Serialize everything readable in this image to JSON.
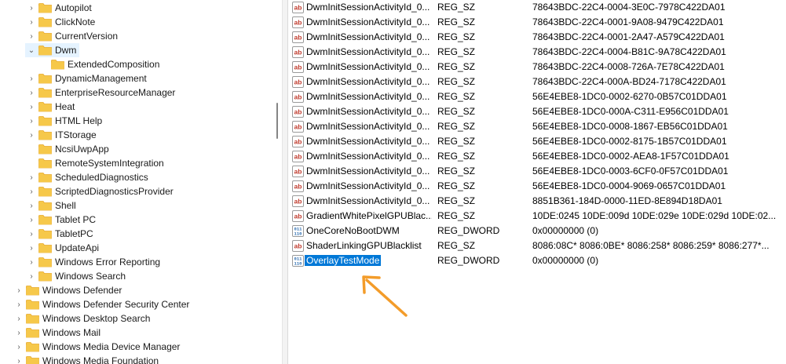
{
  "tree": {
    "items": [
      {
        "label": "Autopilot",
        "expander": "›",
        "level": 2
      },
      {
        "label": "ClickNote",
        "expander": "›",
        "level": 2
      },
      {
        "label": "CurrentVersion",
        "expander": "›",
        "level": 2
      },
      {
        "label": "Dwm",
        "expander": "⌄",
        "level": 2,
        "selected": true
      },
      {
        "label": "ExtendedComposition",
        "expander": "",
        "level": 3
      },
      {
        "label": "DynamicManagement",
        "expander": "›",
        "level": 2
      },
      {
        "label": "EnterpriseResourceManager",
        "expander": "›",
        "level": 2
      },
      {
        "label": "Heat",
        "expander": "›",
        "level": 2
      },
      {
        "label": "HTML Help",
        "expander": "›",
        "level": 2
      },
      {
        "label": "ITStorage",
        "expander": "›",
        "level": 2
      },
      {
        "label": "NcsiUwpApp",
        "expander": "",
        "level": 2
      },
      {
        "label": "RemoteSystemIntegration",
        "expander": "",
        "level": 2
      },
      {
        "label": "ScheduledDiagnostics",
        "expander": "›",
        "level": 2
      },
      {
        "label": "ScriptedDiagnosticsProvider",
        "expander": "›",
        "level": 2
      },
      {
        "label": "Shell",
        "expander": "›",
        "level": 2
      },
      {
        "label": "Tablet PC",
        "expander": "›",
        "level": 2
      },
      {
        "label": "TabletPC",
        "expander": "›",
        "level": 2
      },
      {
        "label": "UpdateApi",
        "expander": "›",
        "level": 2
      },
      {
        "label": "Windows Error Reporting",
        "expander": "›",
        "level": 2
      },
      {
        "label": "Windows Search",
        "expander": "›",
        "level": 2
      },
      {
        "label": "Windows Defender",
        "expander": "›",
        "level": 1
      },
      {
        "label": "Windows Defender Security Center",
        "expander": "›",
        "level": 1
      },
      {
        "label": "Windows Desktop Search",
        "expander": "›",
        "level": 1
      },
      {
        "label": "Windows Mail",
        "expander": "›",
        "level": 1
      },
      {
        "label": "Windows Media Device Manager",
        "expander": "›",
        "level": 1
      },
      {
        "label": "Windows Media Foundation",
        "expander": "›",
        "level": 1
      }
    ]
  },
  "values": {
    "rows": [
      {
        "icon": "string-value-icon",
        "name": "DwmInitSessionActivityId_0...",
        "type": "REG_SZ",
        "data": "78643BDC-22C4-0004-3E0C-7978C422DA01"
      },
      {
        "icon": "string-value-icon",
        "name": "DwmInitSessionActivityId_0...",
        "type": "REG_SZ",
        "data": "78643BDC-22C4-0001-9A08-9479C422DA01"
      },
      {
        "icon": "string-value-icon",
        "name": "DwmInitSessionActivityId_0...",
        "type": "REG_SZ",
        "data": "78643BDC-22C4-0001-2A47-A579C422DA01"
      },
      {
        "icon": "string-value-icon",
        "name": "DwmInitSessionActivityId_0...",
        "type": "REG_SZ",
        "data": "78643BDC-22C4-0004-B81C-9A78C422DA01"
      },
      {
        "icon": "string-value-icon",
        "name": "DwmInitSessionActivityId_0...",
        "type": "REG_SZ",
        "data": "78643BDC-22C4-0008-726A-7E78C422DA01"
      },
      {
        "icon": "string-value-icon",
        "name": "DwmInitSessionActivityId_0...",
        "type": "REG_SZ",
        "data": "78643BDC-22C4-000A-BD24-7178C422DA01"
      },
      {
        "icon": "string-value-icon",
        "name": "DwmInitSessionActivityId_0...",
        "type": "REG_SZ",
        "data": "56E4EBE8-1DC0-0002-6270-0B57C01DDA01"
      },
      {
        "icon": "string-value-icon",
        "name": "DwmInitSessionActivityId_0...",
        "type": "REG_SZ",
        "data": "56E4EBE8-1DC0-000A-C311-E956C01DDA01"
      },
      {
        "icon": "string-value-icon",
        "name": "DwmInitSessionActivityId_0...",
        "type": "REG_SZ",
        "data": "56E4EBE8-1DC0-0008-1867-EB56C01DDA01"
      },
      {
        "icon": "string-value-icon",
        "name": "DwmInitSessionActivityId_0...",
        "type": "REG_SZ",
        "data": "56E4EBE8-1DC0-0002-8175-1B57C01DDA01"
      },
      {
        "icon": "string-value-icon",
        "name": "DwmInitSessionActivityId_0...",
        "type": "REG_SZ",
        "data": "56E4EBE8-1DC0-0002-AEA8-1F57C01DDA01"
      },
      {
        "icon": "string-value-icon",
        "name": "DwmInitSessionActivityId_0...",
        "type": "REG_SZ",
        "data": "56E4EBE8-1DC0-0003-6CF0-0F57C01DDA01"
      },
      {
        "icon": "string-value-icon",
        "name": "DwmInitSessionActivityId_0...",
        "type": "REG_SZ",
        "data": "56E4EBE8-1DC0-0004-9069-0657C01DDA01"
      },
      {
        "icon": "string-value-icon",
        "name": "DwmInitSessionActivityId_0...",
        "type": "REG_SZ",
        "data": "8851B361-184D-0000-11ED-8E894D18DA01"
      },
      {
        "icon": "string-value-icon",
        "name": "GradientWhitePixelGPUBlac...",
        "type": "REG_SZ",
        "data": "10DE:0245 10DE:009d 10DE:029e 10DE:029d 10DE:02..."
      },
      {
        "icon": "binary-value-icon",
        "name": "OneCoreNoBootDWM",
        "type": "REG_DWORD",
        "data": "0x00000000 (0)"
      },
      {
        "icon": "string-value-icon",
        "name": "ShaderLinkingGPUBlacklist",
        "type": "REG_SZ",
        "data": "8086:08C* 8086:0BE* 8086:258* 8086:259* 8086:277*..."
      },
      {
        "icon": "binary-value-icon",
        "name": "OverlayTestMode",
        "type": "REG_DWORD",
        "data": "0x00000000 (0)",
        "selected": true
      }
    ]
  },
  "colors": {
    "folder": "#f6c84a",
    "folder_dark": "#e8a92a",
    "selection": "#0078d7",
    "arrow": "#f39c2a",
    "string_icon": "#c0392b",
    "binary_icon": "#2b6cb0"
  }
}
